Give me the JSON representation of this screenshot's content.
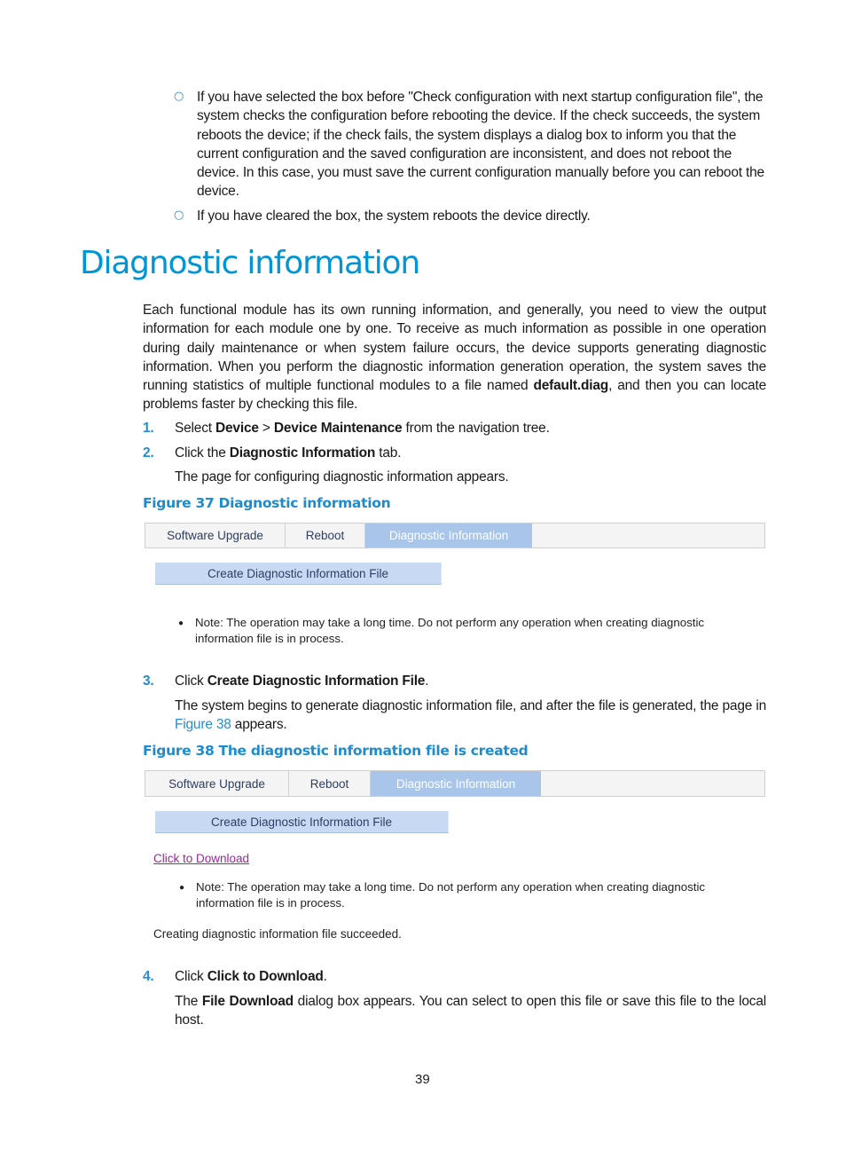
{
  "intro_bullets": [
    {
      "marker": "○",
      "text": "If you have selected the box before \"Check configuration with next startup configuration file\", the system checks the configuration before rebooting the device. If the check succeeds, the system reboots the device; if the check fails, the system displays a dialog box to inform you that the current configuration and the saved configuration are inconsistent, and does not reboot the device. In this case, you must save the current configuration manually before you can reboot the device."
    },
    {
      "marker": "○",
      "text": "If you have cleared the box, the system reboots the device directly."
    }
  ],
  "section": {
    "title": "Diagnostic information",
    "paragraph_before": "Each functional module has its own running information, and generally, you need to view the output information for each module one by one. To receive as much information as possible in one operation during daily maintenance or when system failure occurs, the device supports generating diagnostic information. When you perform the diagnostic information generation operation, the system saves the running statistics of multiple functional modules to a file named ",
    "paragraph_bold": "default.diag",
    "paragraph_after": ", and then you can locate problems faster by checking this file."
  },
  "steps": [
    {
      "num": "1.",
      "pre": "Select ",
      "b1": "Device",
      "mid": " > ",
      "b2": "Device Maintenance",
      "post": " from the navigation tree."
    },
    {
      "num": "2.",
      "pre": "Click the ",
      "b1": "Diagnostic Information",
      "post": " tab.",
      "result": "The page for configuring diagnostic information appears."
    },
    {
      "num": "3.",
      "pre": "Click ",
      "b1": "Create Diagnostic Information File",
      "post": ".",
      "result_pre": "The system begins to generate diagnostic information file, and after the file is generated, the page in ",
      "result_link": "Figure 38",
      "result_post": " appears."
    },
    {
      "num": "4.",
      "pre": "Click ",
      "b1": "Click to Download",
      "post": ".",
      "result_pre": "The ",
      "result_bold": "File Download",
      "result_post": " dialog box appears. You can select to open this file or save this file to the local host."
    }
  ],
  "figure37": {
    "caption": "Figure 37 Diagnostic information",
    "tabs": [
      "Software Upgrade",
      "Reboot",
      "Diagnostic Information"
    ],
    "active_tab": "Diagnostic Information",
    "button": "Create Diagnostic Information File",
    "note_bullet": "●",
    "note_line1": "Note: The operation may take a long time. Do not perform any operation when creating diagnostic",
    "note_line2": "information file is in process."
  },
  "figure38": {
    "caption": "Figure 38 The diagnostic information file is created",
    "tabs": [
      "Software Upgrade",
      "Reboot",
      "Diagnostic Information"
    ],
    "active_tab": "Diagnostic Information",
    "button": "Create Diagnostic Information File",
    "download_link": "Click to Download",
    "note_bullet": "●",
    "note_line1": "Note: The operation may take a long time. Do not perform any operation when creating diagnostic",
    "note_line2": "information file is in process.",
    "status": "Creating diagnostic information file succeeded."
  },
  "colors": {
    "heading": "#0096d6",
    "accent": "#2a8ccf",
    "active_tab": "#a9c6ea",
    "button_bg": "#c8daf3",
    "link_visited": "#a0249a"
  },
  "page_number": "39"
}
